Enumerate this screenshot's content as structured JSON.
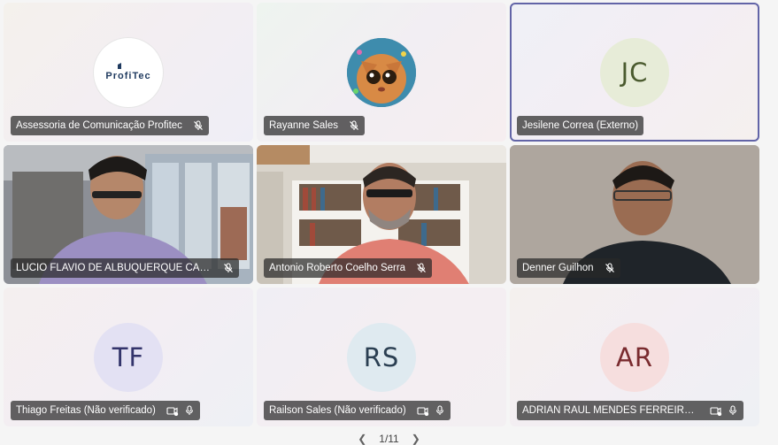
{
  "participants": [
    {
      "name": "Assessoria de Comunicação Profitec",
      "avatar_type": "logo",
      "logo_text": "ProfiTec",
      "mic_icon": "mic-off-icon"
    },
    {
      "name": "Rayanne Sales",
      "avatar_type": "image",
      "mic_icon": "mic-off-icon"
    },
    {
      "name": "Jesilene Correa (Externo)",
      "avatar_type": "initials",
      "initials": "JC",
      "active_speaker": true
    },
    {
      "name": "LUCIO FLAVIO DE ALBUQUERQUE CAM...",
      "avatar_type": "video",
      "mic_icon": "mic-off-icon"
    },
    {
      "name": "Antonio Roberto Coelho Serra",
      "avatar_type": "video",
      "mic_icon": "mic-off-icon"
    },
    {
      "name": "Denner Guilhon",
      "avatar_type": "video",
      "mic_icon": "mic-off-icon"
    },
    {
      "name": "Thiago Freitas (Não verificado)",
      "avatar_type": "initials",
      "initials": "TF",
      "extra_icons": [
        "unverified-icon",
        "mic-icon"
      ]
    },
    {
      "name": "Railson Sales (Não verificado)",
      "avatar_type": "initials",
      "initials": "RS",
      "extra_icons": [
        "unverified-icon",
        "mic-icon"
      ]
    },
    {
      "name": "ADRIAN RAUL MENDES FERREIRA R...",
      "avatar_type": "initials",
      "initials": "AR",
      "extra_icons": [
        "unverified-icon",
        "mic-icon"
      ]
    }
  ],
  "pager": {
    "label": "1/11"
  },
  "colors": {
    "active_border": "#6264a7",
    "namebar_bg": "rgba(40,40,40,0.72)"
  }
}
